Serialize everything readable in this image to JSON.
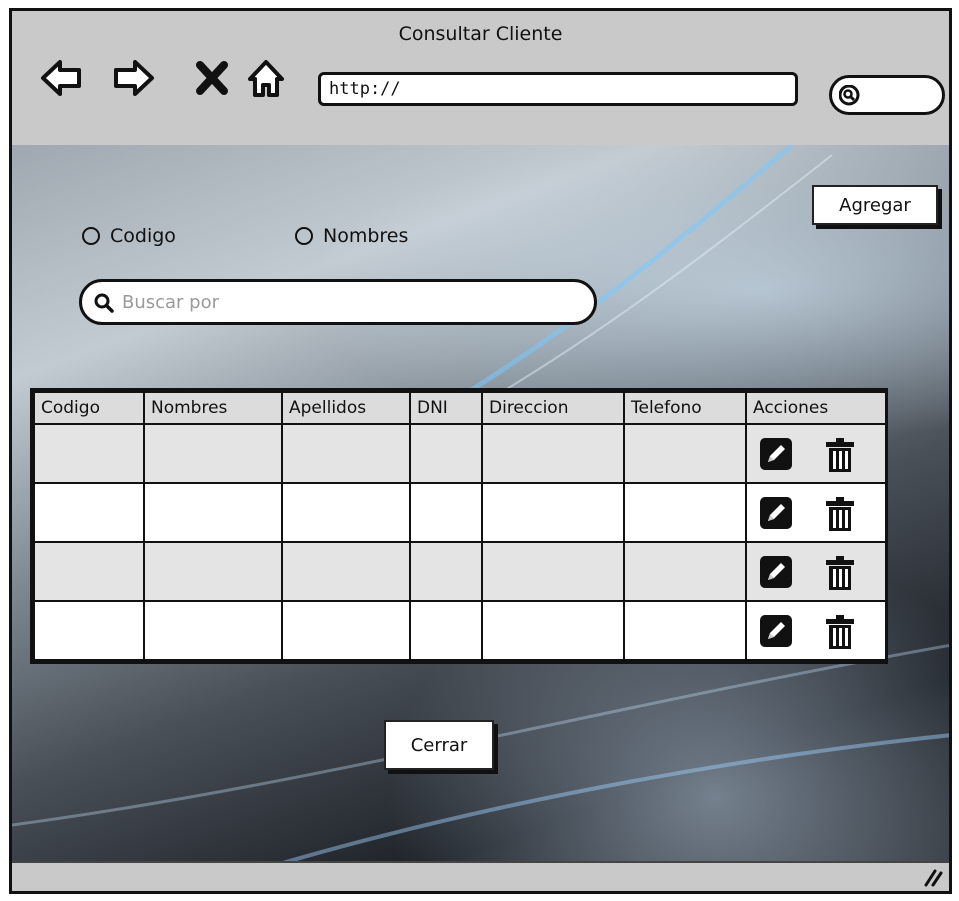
{
  "window": {
    "title": "Consultar Cliente"
  },
  "toolbar": {
    "url_value": "http://",
    "icons": [
      "back-arrow-icon",
      "forward-arrow-icon",
      "close-icon",
      "home-icon",
      "search-icon"
    ]
  },
  "form": {
    "add_button_label": "Agregar",
    "radio_options": [
      {
        "label": "Codigo",
        "selected": false
      },
      {
        "label": "Nombres",
        "selected": false
      }
    ],
    "search": {
      "placeholder": "Buscar por",
      "value": ""
    }
  },
  "table": {
    "columns": [
      "Codigo",
      "Nombres",
      "Apellidos",
      "DNI",
      "Direccion",
      "Telefono",
      "Acciones"
    ],
    "rows": [
      [
        "",
        "",
        "",
        "",
        "",
        ""
      ],
      [
        "",
        "",
        "",
        "",
        "",
        ""
      ],
      [
        "",
        "",
        "",
        "",
        "",
        ""
      ],
      [
        "",
        "",
        "",
        "",
        "",
        ""
      ]
    ],
    "row_action_icons": [
      "pencil-icon",
      "trash-icon"
    ]
  },
  "footer": {
    "close_button_label": "Cerrar"
  },
  "colors": {
    "window_chrome": "#c9c9c9",
    "row_alt": "#e4e4e4",
    "border": "#111111"
  }
}
